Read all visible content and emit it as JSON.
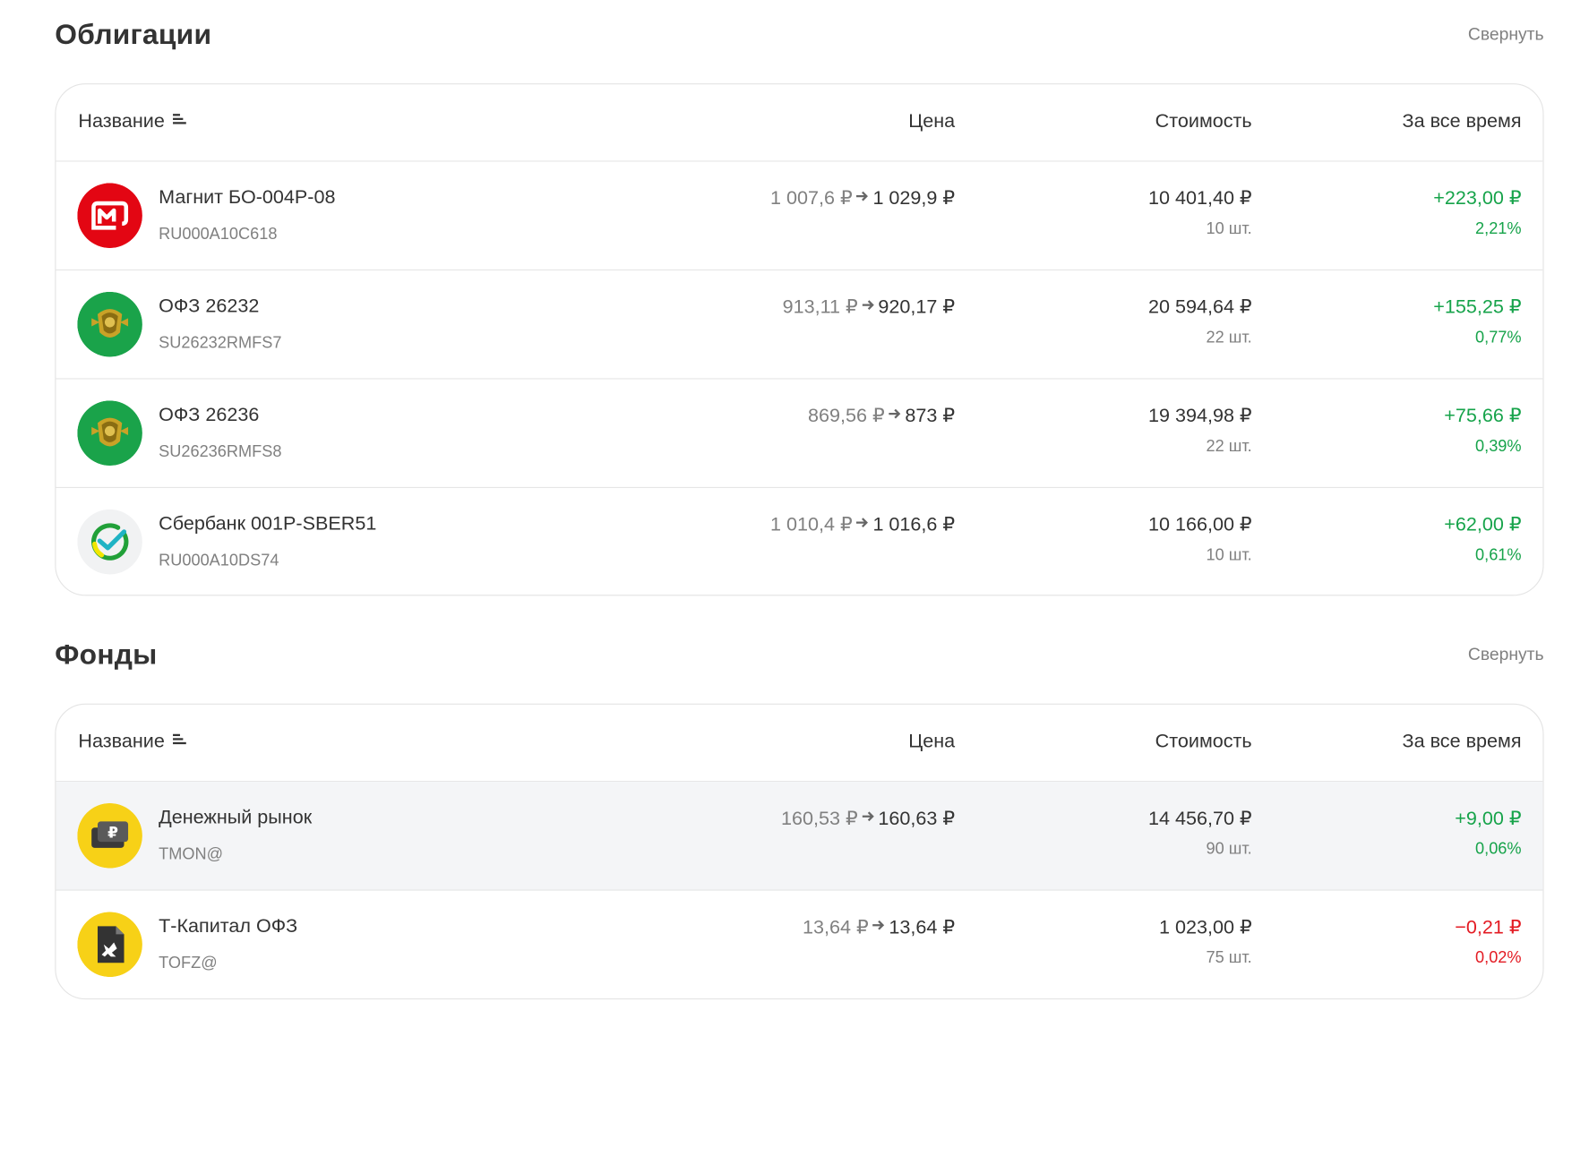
{
  "colors": {
    "positive": "#16a34a",
    "negative": "#e31b23",
    "muted": "#808080",
    "text": "#333333"
  },
  "bonds": {
    "title": "Облигации",
    "collapse_label": "Свернуть",
    "columns": {
      "name": "Название",
      "price": "Цена",
      "cost": "Стоимость",
      "all_time": "За все время"
    },
    "rows": [
      {
        "icon": "magnit-logo-icon",
        "name": "Магнит БО-004Р-08",
        "ticker": "RU000A10C618",
        "price_old": "1 007,6 ₽",
        "price_new": "1 029,9 ₽",
        "cost": "10 401,40 ₽",
        "qty": "10 шт.",
        "gain": "+223,00 ₽",
        "gain_pct": "2,21%",
        "trend": "positive"
      },
      {
        "icon": "minfin-emblem-icon",
        "name": "ОФЗ 26232",
        "ticker": "SU26232RMFS7",
        "price_old": "913,11 ₽",
        "price_new": "920,17 ₽",
        "cost": "20 594,64 ₽",
        "qty": "22 шт.",
        "gain": "+155,25 ₽",
        "gain_pct": "0,77%",
        "trend": "positive"
      },
      {
        "icon": "minfin-emblem-icon",
        "name": "ОФЗ 26236",
        "ticker": "SU26236RMFS8",
        "price_old": "869,56 ₽",
        "price_new": "873 ₽",
        "cost": "19 394,98 ₽",
        "qty": "22 шт.",
        "gain": "+75,66 ₽",
        "gain_pct": "0,39%",
        "trend": "positive"
      },
      {
        "icon": "sber-logo-icon",
        "name": "Сбербанк 001P-SBER51",
        "ticker": "RU000A10DS74",
        "price_old": "1 010,4 ₽",
        "price_new": "1 016,6 ₽",
        "cost": "10 166,00 ₽",
        "qty": "10 шт.",
        "gain": "+62,00 ₽",
        "gain_pct": "0,61%",
        "trend": "positive"
      }
    ]
  },
  "funds": {
    "title": "Фонды",
    "collapse_label": "Свернуть",
    "columns": {
      "name": "Название",
      "price": "Цена",
      "cost": "Стоимость",
      "all_time": "За все время"
    },
    "rows": [
      {
        "icon": "money-market-fund-icon",
        "name": "Денежный рынок",
        "ticker": "TMON@",
        "price_old": "160,53 ₽",
        "price_new": "160,63 ₽",
        "cost": "14 456,70 ₽",
        "qty": "90 шт.",
        "gain": "+9,00 ₽",
        "gain_pct": "0,06%",
        "trend": "positive"
      },
      {
        "icon": "ofz-fund-icon",
        "name": "Т-Капитал ОФЗ",
        "ticker": "TOFZ@",
        "price_old": "13,64 ₽",
        "price_new": "13,64 ₽",
        "cost": "1 023,00 ₽",
        "qty": "75 шт.",
        "gain": "−0,21 ₽",
        "gain_pct": "0,02%",
        "trend": "negative"
      }
    ]
  }
}
